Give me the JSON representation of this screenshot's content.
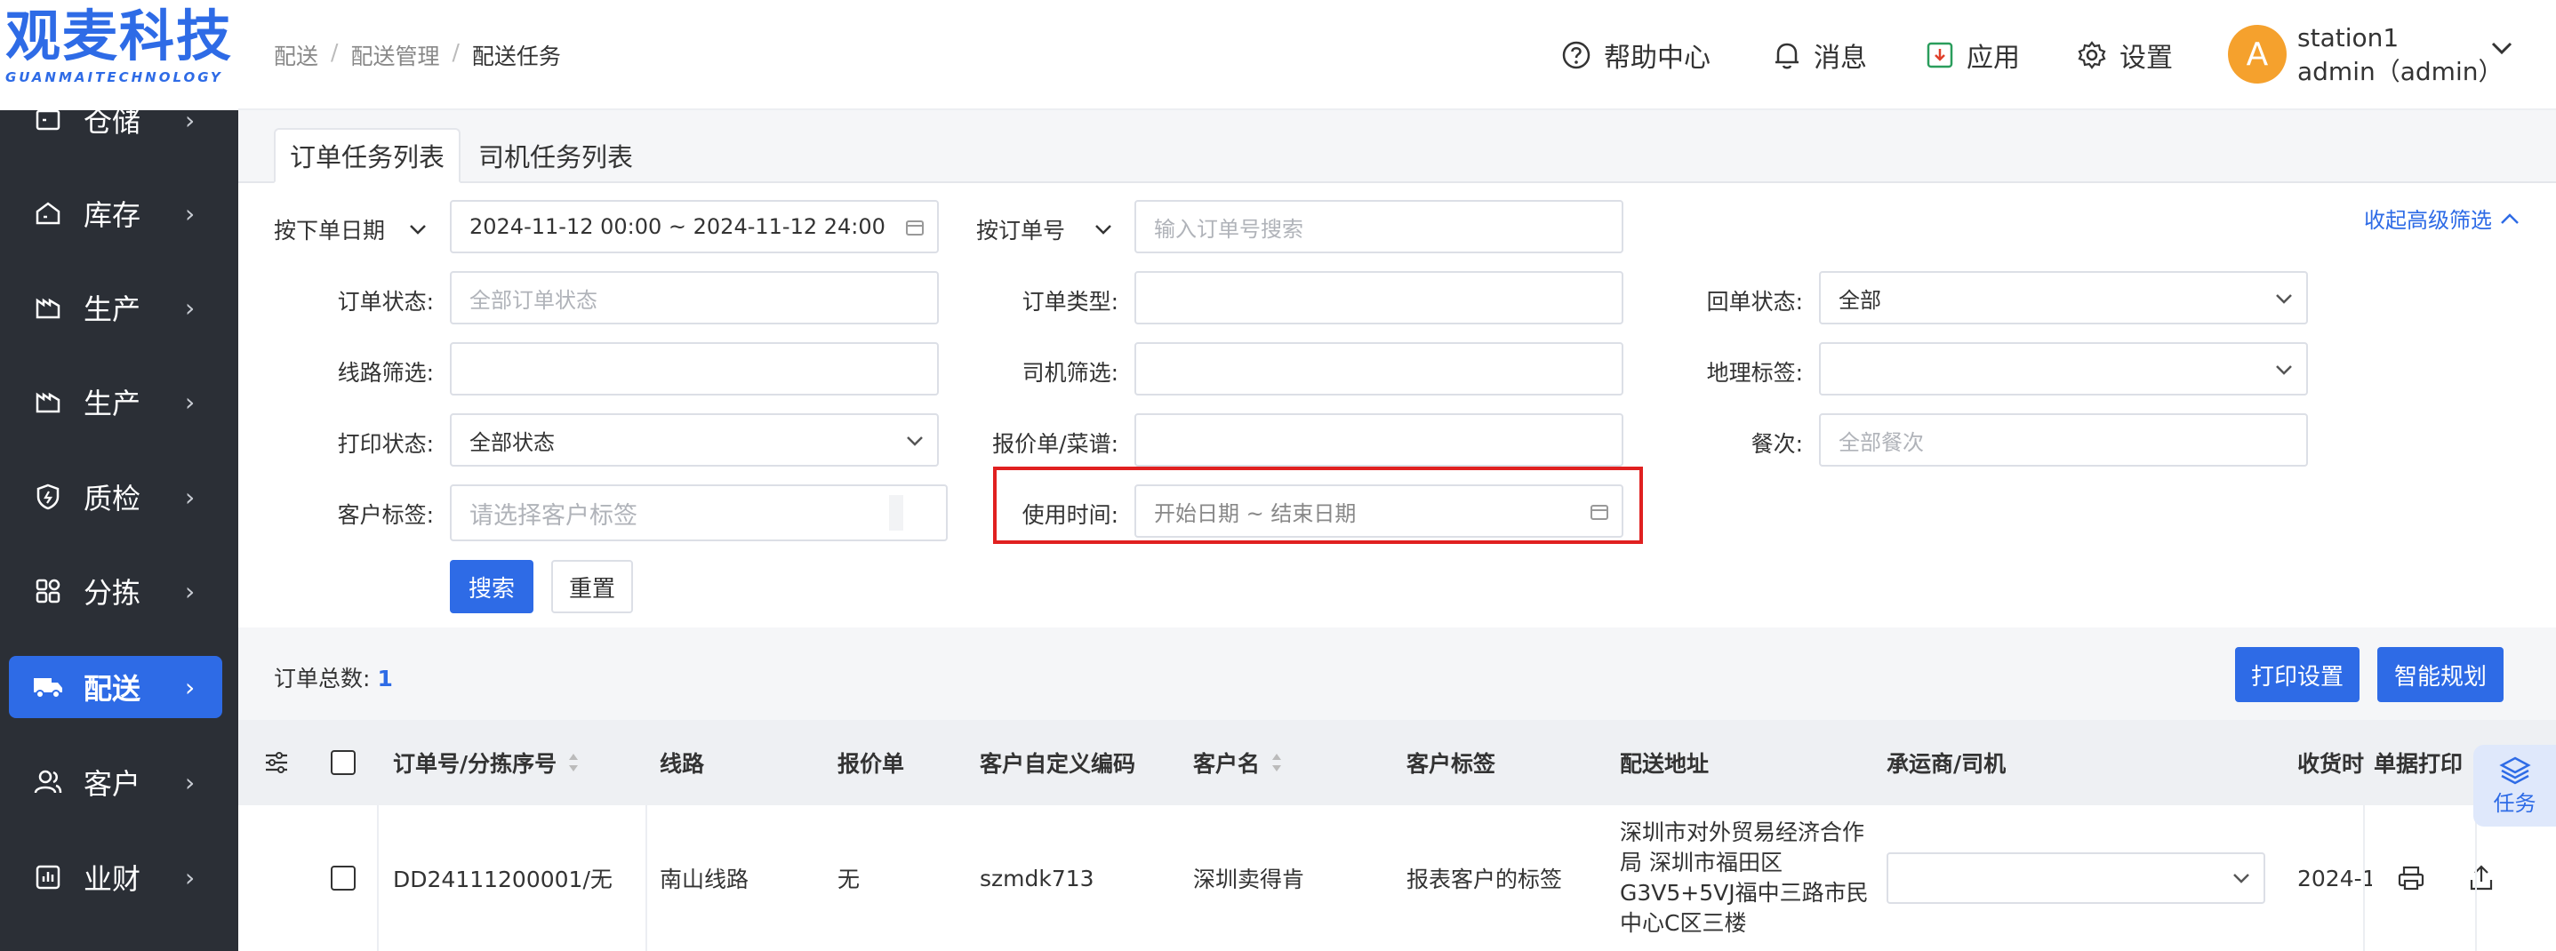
{
  "logo": {
    "main": "观麦科技",
    "sub": "GUANMAITECHNOLOGY"
  },
  "sidebar": {
    "items": [
      {
        "label": "仓储",
        "icon": "warehouse-icon"
      },
      {
        "label": "库存",
        "icon": "inventory-icon"
      },
      {
        "label": "生产",
        "icon": "factory-icon"
      },
      {
        "label": "生产",
        "icon": "factory-icon"
      },
      {
        "label": "质检",
        "icon": "quality-shield-icon"
      },
      {
        "label": "分拣",
        "icon": "sorting-icon"
      },
      {
        "label": "配送",
        "icon": "truck-icon",
        "active": true
      },
      {
        "label": "客户",
        "icon": "customer-icon"
      },
      {
        "label": "业财",
        "icon": "finance-icon"
      }
    ]
  },
  "breadcrumb": {
    "level1": "配送",
    "level2": "配送管理",
    "current": "配送任务",
    "separator": "/"
  },
  "header": {
    "help": "帮助中心",
    "messages": "消息",
    "apps": "应用",
    "settings": "设置",
    "avatar_letter": "A",
    "station": "station1",
    "user": "admin（admin）"
  },
  "tabs": [
    {
      "label": "订单任务列表",
      "active": true
    },
    {
      "label": "司机任务列表",
      "active": false
    }
  ],
  "filters": {
    "date_type": "按下单日期",
    "date_range": "2024-11-12 00:00 ~ 2024-11-12 24:00",
    "order_no_type": "按订单号",
    "order_no_placeholder": "输入订单号搜索",
    "advanced_toggle": "收起高级筛选",
    "order_status_label": "订单状态:",
    "order_status_placeholder": "全部订单状态",
    "order_type_label": "订单类型:",
    "return_status_label": "回单状态:",
    "return_status_value": "全部",
    "route_label": "线路筛选:",
    "driver_label": "司机筛选:",
    "geo_tag_label": "地理标签:",
    "print_status_label": "打印状态:",
    "print_status_value": "全部状态",
    "quote_label": "报价单/菜谱:",
    "meal_label": "餐次:",
    "meal_placeholder": "全部餐次",
    "customer_tag_label": "客户标签:",
    "customer_tag_placeholder": "请选择客户标签",
    "use_time_label": "使用时间:",
    "use_time_placeholder": "开始日期 ~ 结束日期",
    "search_button": "搜索",
    "reset_button": "重置"
  },
  "summary": {
    "total_label": "订单总数:",
    "total_value": "1",
    "print_settings": "打印设置",
    "smart_plan": "智能规划"
  },
  "table": {
    "headers": [
      "订单号/分拣序号",
      "线路",
      "报价单",
      "客户自定义编码",
      "客户名",
      "客户标签",
      "配送地址",
      "承运商/司机",
      "收货时",
      "单据打印"
    ],
    "rows": [
      {
        "order_no": "DD24111200001/无",
        "route": "南山线路",
        "quote": "无",
        "custom_code": "szmdk713",
        "customer": "深圳卖得肯",
        "customer_tag": "报表客户的标签",
        "address": "深圳市对外贸易经济合作局 深圳市福田区G3V5+5VJ福中三路市民中心C区三楼",
        "receive_time": "2024-1"
      }
    ]
  },
  "task_button": "任务",
  "colors": {
    "primary": "#2e6be6",
    "sidebar": "#2b2f36",
    "highlight": "#e02020",
    "avatar": "#f5a12d"
  }
}
